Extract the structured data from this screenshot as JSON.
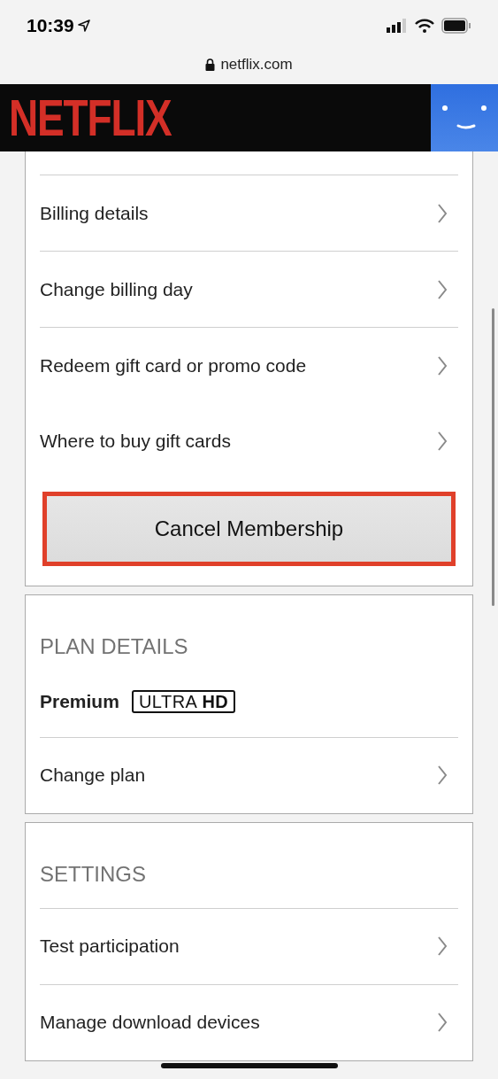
{
  "status_bar": {
    "time": "10:39"
  },
  "browser": {
    "url": "netflix.com"
  },
  "header": {
    "logo": "NETFLIX"
  },
  "billing": {
    "items": [
      {
        "label": "Billing details"
      },
      {
        "label": "Change billing day"
      },
      {
        "label": "Redeem gift card or promo code"
      },
      {
        "label": "Where to buy gift cards"
      }
    ],
    "cancel_button": "Cancel Membership"
  },
  "plan": {
    "heading": "PLAN DETAILS",
    "plan_name": "Premium",
    "badge": {
      "light": "ULTRA",
      "bold": "HD"
    },
    "items": [
      {
        "label": "Change plan"
      }
    ]
  },
  "settings": {
    "heading": "SETTINGS",
    "items": [
      {
        "label": "Test participation"
      },
      {
        "label": "Manage download devices"
      }
    ]
  }
}
